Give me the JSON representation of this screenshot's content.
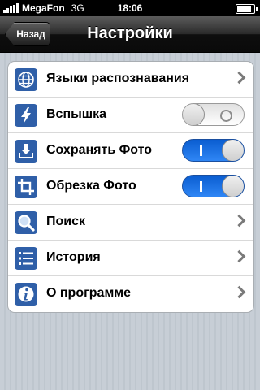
{
  "status": {
    "carrier": "MegaFon",
    "network": "3G",
    "time": "18:06",
    "battery_level": 0.85
  },
  "nav": {
    "back_label": "Назад",
    "title": "Настройки"
  },
  "settings": {
    "items": [
      {
        "label": "Языки распознавания",
        "icon": "globe-icon",
        "control": "chevron"
      },
      {
        "label": "Вспышка",
        "icon": "flash-icon",
        "control": "toggle",
        "value": false
      },
      {
        "label": "Сохранять Фото",
        "icon": "download-icon",
        "control": "toggle",
        "value": true
      },
      {
        "label": "Обрезка Фото",
        "icon": "crop-icon",
        "control": "toggle",
        "value": true
      },
      {
        "label": "Поиск",
        "icon": "magnifier-icon",
        "control": "chevron"
      },
      {
        "label": "История",
        "icon": "list-icon",
        "control": "chevron"
      },
      {
        "label": "О программе",
        "icon": "info-icon",
        "control": "chevron"
      }
    ]
  },
  "colors": {
    "icon_blue": "#2f5fa8",
    "toggle_on": "#1f74ea",
    "group_bg": "#ffffff"
  }
}
